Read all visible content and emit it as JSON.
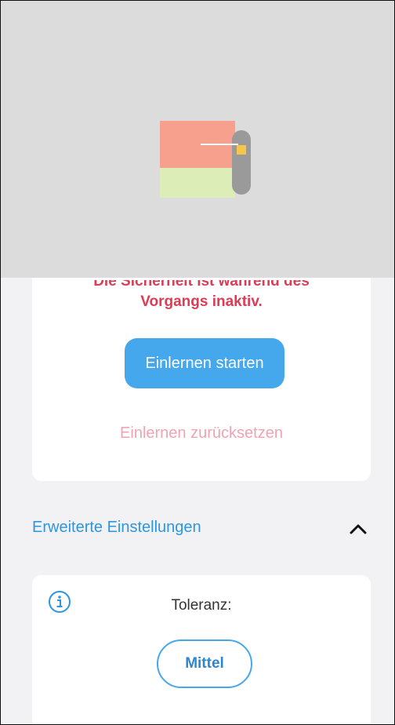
{
  "teach_card": {
    "warning_line1": "Die Sicherheit ist während des",
    "warning_line2": "Vorgangs inaktiv.",
    "start_button": "Einlernen starten",
    "reset_link": "Einlernen zurücksetzen"
  },
  "advanced": {
    "title": "Erweiterte Einstellungen",
    "tolerance_label": "Toleranz:",
    "tolerance_value": "Mittel"
  },
  "colors": {
    "accent": "#45a7ec",
    "warning": "#dc3c55",
    "reset_link": "#f0a3b1",
    "section_title": "#2c97e0"
  },
  "icons": {
    "overlay": "window-sash-illustration",
    "collapse": "chevron-up-icon",
    "info": "info-icon"
  }
}
